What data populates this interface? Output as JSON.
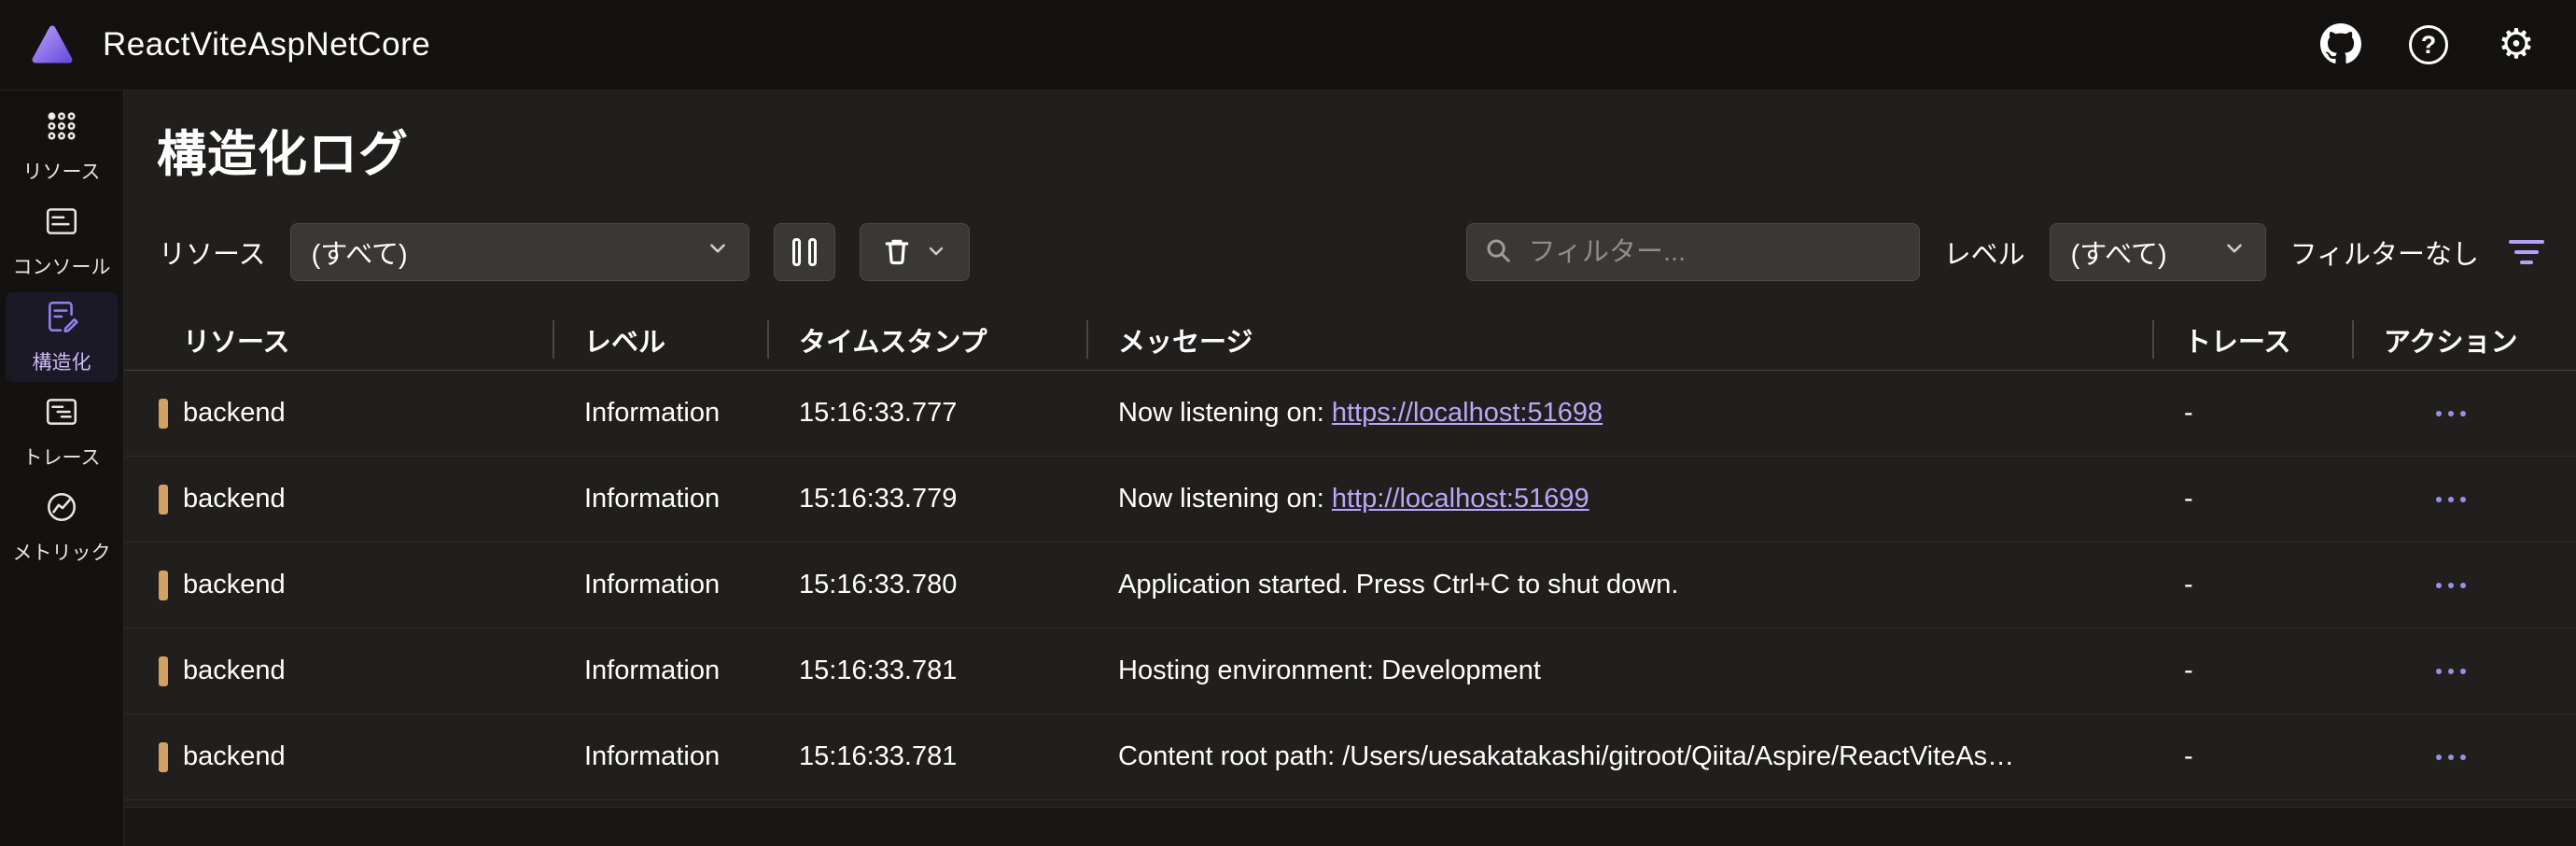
{
  "header": {
    "title": "ReactViteAspNetCore"
  },
  "icons": {
    "help": "?",
    "settings": "⚙"
  },
  "sidebar": {
    "items": [
      {
        "label": "リソース"
      },
      {
        "label": "コンソール"
      },
      {
        "label": "構造化"
      },
      {
        "label": "トレース"
      },
      {
        "label": "メトリック"
      }
    ]
  },
  "page": {
    "title": "構造化ログ"
  },
  "toolbar": {
    "resource_label": "リソース",
    "resource_value": "(すべて)",
    "filter_placeholder": "フィルター...",
    "level_label": "レベル",
    "level_value": "(すべて)",
    "no_filters_label": "フィルターなし"
  },
  "table": {
    "columns": [
      "リソース",
      "レベル",
      "タイムスタンプ",
      "メッセージ",
      "トレース",
      "アクション"
    ],
    "rows": [
      {
        "resource": "backend",
        "level": "Information",
        "timestamp": "15:16:33.777",
        "message_prefix": "Now listening on: ",
        "message_link": "https://localhost:51698",
        "trace": "-"
      },
      {
        "resource": "backend",
        "level": "Information",
        "timestamp": "15:16:33.779",
        "message_prefix": "Now listening on: ",
        "message_link": "http://localhost:51699",
        "trace": "-"
      },
      {
        "resource": "backend",
        "level": "Information",
        "timestamp": "15:16:33.780",
        "message": "Application started. Press Ctrl+C to shut down.",
        "trace": "-"
      },
      {
        "resource": "backend",
        "level": "Information",
        "timestamp": "15:16:33.781",
        "message": "Hosting environment: Development",
        "trace": "-"
      },
      {
        "resource": "backend",
        "level": "Information",
        "timestamp": "15:16:33.781",
        "message": "Content root path: /Users/uesakatakashi/gitroot/Qiita/Aspire/ReactViteAs…",
        "trace": "-"
      }
    ]
  },
  "colors": {
    "accent": "#9381f0",
    "link": "#b9a8f7",
    "resource_bar": "#d2a262",
    "background": "#201f1e",
    "surface": "#131211"
  }
}
